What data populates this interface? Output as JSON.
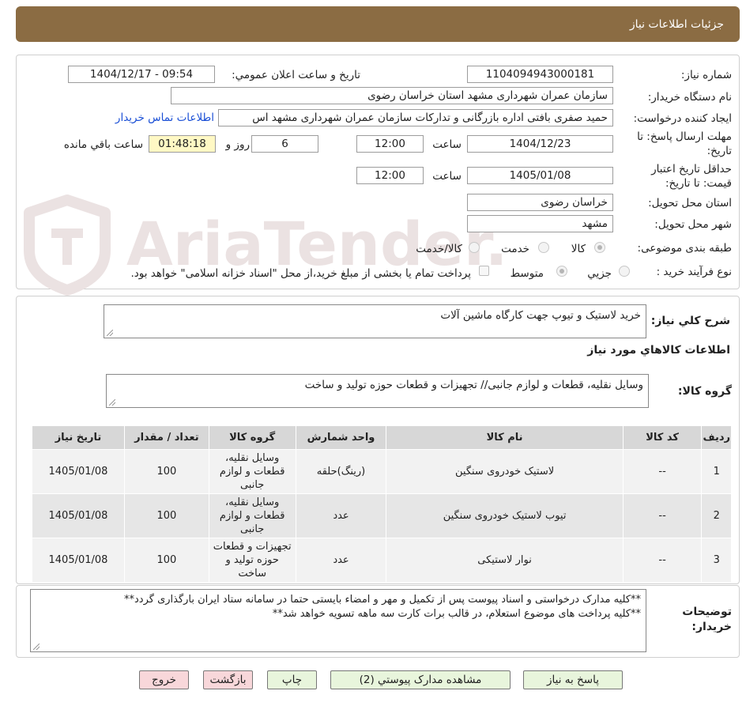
{
  "header": {
    "title": "جزئیات اطلاعات نیاز"
  },
  "form": {
    "need_number_label": "شماره نیاز:",
    "need_number": "1104094943000181",
    "announce_label": "تاریخ و ساعت اعلان عمومي:",
    "announce_value": "1404/12/17 - 09:54",
    "buyer_org_label": "نام دستگاه خریدار:",
    "buyer_org": "سازمان عمران شهرداری مشهد استان خراسان رضوی",
    "requester_label": "ایجاد کننده درخواست:",
    "requester": "حمید صفری بافتی اداره بازرگانی و تدارکات  سازمان عمران شهرداری مشهد اس",
    "contact_link": "اطلاعات تماس خریدار",
    "deadline_label_1": "مهلت ارسال پاسخ: تا",
    "deadline_label_2": "تاریخ:",
    "deadline_date": "1404/12/23",
    "time_label": "ساعت",
    "deadline_time": "12:00",
    "days_value": "6",
    "days_label": "روز و",
    "remaining_value": "01:48:18",
    "remaining_label": "ساعت باقي مانده",
    "validity_label_1": "حداقل تاریخ اعتبار",
    "validity_label_2": "قیمت: تا تاریخ:",
    "validity_date": "1405/01/08",
    "validity_time_label": "ساعت",
    "validity_time": "12:00",
    "province_label": "استان محل تحویل:",
    "province": "خراسان رضوی",
    "city_label": "شهر محل تحویل:",
    "city": "مشهد",
    "category_label": "طبقه بندی موضوعی:",
    "category_options": [
      "کالا",
      "خدمت",
      "کالا/خدمت"
    ],
    "process_label": "نوع فرآیند خرید :",
    "process_options": [
      "جزیي",
      "متوسط"
    ],
    "payment_note": "پرداخت تمام یا بخشی از مبلغ خرید،از محل \"اسناد خزانه اسلامی\" خواهد بود."
  },
  "description": {
    "label": "شرح کلي نیاز:",
    "value": "خرید لاستیک و تیوپ جهت کارگاه ماشین آلات"
  },
  "goods": {
    "section_title": "اطلاعات کالاهاي مورد نیاز",
    "group_label": "گروه کالا:",
    "group_value": "وسایل نقلیه، قطعات و لوازم جانبی// تجهیزات و قطعات حوزه تولید و ساخت",
    "columns": [
      "ردیف",
      "کد کالا",
      "نام کالا",
      "واحد شمارش",
      "گروه کالا",
      "تعداد / مقدار",
      "تاریخ نیاز"
    ],
    "rows": [
      {
        "row": "1",
        "code": "--",
        "name": "لاستیک خودروی سنگین",
        "unit": "(رینگ)حلقه",
        "group": "وسایل نقلیه، قطعات و لوازم جانبی",
        "qty": "100",
        "date": "1405/01/08"
      },
      {
        "row": "2",
        "code": "--",
        "name": "تیوب لاستیک خودروی سنگین",
        "unit": "عدد",
        "group": "وسایل نقلیه، قطعات و لوازم جانبی",
        "qty": "100",
        "date": "1405/01/08"
      },
      {
        "row": "3",
        "code": "--",
        "name": "نوار لاستیکی",
        "unit": "عدد",
        "group": "تجهیزات و قطعات حوزه تولید و ساخت",
        "qty": "100",
        "date": "1405/01/08"
      }
    ]
  },
  "notes": {
    "label_1": "توضیحات",
    "label_2": "خریدار:",
    "line_1": "**کلیه مدارک درخواستی و اسناد پیوست پس از تکمیل و مهر و امضاء بایستی حتما در سامانه ستاد ایران بارگذاری گردد**",
    "line_2": "**کلیه پرداخت های موضوع استعلام، در قالب برات کارت سه ماهه تسویه خواهد شد**"
  },
  "buttons": {
    "reply": "پاسخ به نیاز",
    "attachments": "مشاهده مدارک پیوستي (2)",
    "print": "چاپ",
    "back": "بازگشت",
    "exit": "خروج"
  },
  "watermark": {
    "text": "AriaTender.neT"
  },
  "colors": {
    "header": "#8b6c43",
    "link": "#1a4fd6",
    "green_button": "#e8f5dc",
    "pink_button": "#f8d7da",
    "timer": "#fff8c4"
  }
}
